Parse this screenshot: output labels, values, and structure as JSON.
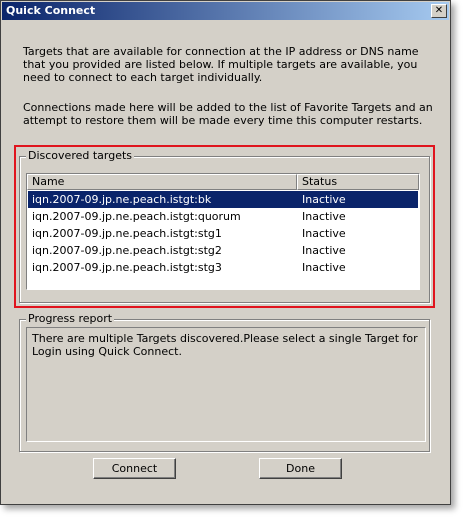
{
  "window": {
    "title": "Quick Connect",
    "close_glyph": "✕"
  },
  "intro": {
    "paragraph1": "Targets that are available for connection at the IP address or DNS name that you provided are listed below.  If multiple targets are available, you need to connect to each target individually.",
    "paragraph2": "Connections made here will be added to the list of Favorite Targets and an attempt to restore them will be made every time this computer restarts."
  },
  "discovered": {
    "label": "Discovered targets",
    "columns": [
      "Name",
      "Status"
    ],
    "rows": [
      {
        "name": "iqn.2007-09.jp.ne.peach.istgt:bk",
        "status": "Inactive"
      },
      {
        "name": "iqn.2007-09.jp.ne.peach.istgt:quorum",
        "status": "Inactive"
      },
      {
        "name": "iqn.2007-09.jp.ne.peach.istgt:stg1",
        "status": "Inactive"
      },
      {
        "name": "iqn.2007-09.jp.ne.peach.istgt:stg2",
        "status": "Inactive"
      },
      {
        "name": "iqn.2007-09.jp.ne.peach.istgt:stg3",
        "status": "Inactive"
      }
    ]
  },
  "progress": {
    "label": "Progress report",
    "message": "There are multiple Targets discovered.Please select a single Target for Login using Quick Connect."
  },
  "buttons": {
    "connect": "Connect",
    "done": "Done"
  },
  "colors": {
    "selection": "#0a246a",
    "highlight_border": "#e0141e"
  }
}
